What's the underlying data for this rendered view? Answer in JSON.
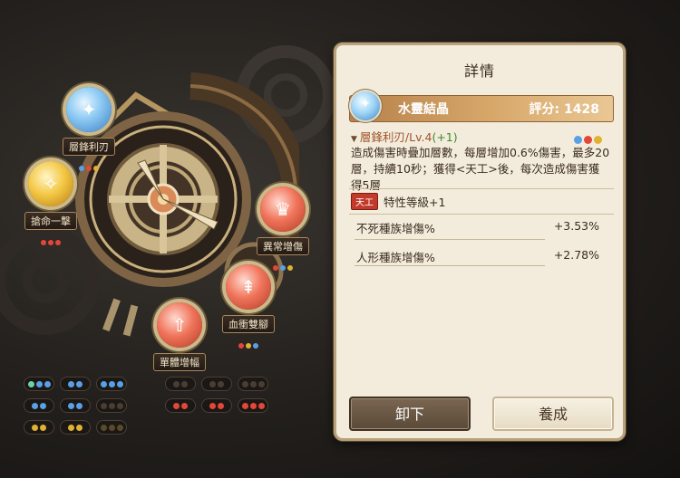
{
  "panel": {
    "title": "詳情",
    "item_name": "水靈結晶",
    "score_label": "評分:",
    "score_value": "1428",
    "skill_name": "層鋒利刃/Lv.4",
    "skill_bonus": "(+1)",
    "description": "造成傷害時疊加層數，每層增加0.6%傷害，最多20層，持續10秒；獲得<天工>後，每次造成傷害獲得5層",
    "trait_badge": "天工",
    "trait_text": "特性等級+1",
    "stats": [
      {
        "label": "不死種族增傷%",
        "value": "+3.53%"
      },
      {
        "label": "人形種族增傷%",
        "value": "+2.78%"
      }
    ],
    "buttons": {
      "unequip": "卸下",
      "develop": "養成"
    },
    "skill_dot_colors": [
      "#5aa0e6",
      "#e2473a",
      "#e0b232"
    ]
  },
  "nodes": [
    {
      "label": "層鋒利刃",
      "icon": "blade-icon",
      "orb": "blue",
      "dots": [
        "#5aa0e6",
        "#e2473a",
        "#e0b232"
      ]
    },
    {
      "label": "搶命一擊",
      "icon": "strike-icon",
      "orb": "gold",
      "dots": [
        "#e2473a",
        "#e2473a",
        "#e2473a"
      ]
    },
    {
      "label": "異常增傷",
      "icon": "crown-icon",
      "orb": "red",
      "dots": [
        "#e2473a",
        "#5aa0e6",
        "#e0b232"
      ]
    },
    {
      "label": "血衝雙腳",
      "icon": "double-strike-icon",
      "orb": "red",
      "dots": [
        "#e2473a",
        "#e0b232",
        "#5aa0e6"
      ]
    },
    {
      "label": "單體增幅",
      "icon": "single-boost-icon",
      "orb": "red",
      "dots": [
        "#e2473a",
        "#e2473a",
        "#e0b232"
      ]
    }
  ],
  "slot_rows": [
    [
      [
        "#6fd0a8",
        "#5aa0e6",
        "#5aa0e6"
      ],
      [
        "#5aa0e6",
        "#5aa0e6"
      ],
      [
        "#5aa0e6",
        "#5aa0e6",
        "#5aa0e6"
      ],
      [
        "#4a3d33",
        "#4a3d33"
      ],
      [
        "#4a3d33",
        "#4a3d33"
      ],
      [
        "#4a3d33",
        "#4a3d33",
        "#4a3d33"
      ]
    ],
    [
      [
        "#5aa0e6",
        "#5aa0e6"
      ],
      [
        "#5aa0e6",
        "#5aa0e6"
      ],
      [
        "#4a3d33",
        "#4a3d33",
        "#4a3d33"
      ],
      [
        "#e2473a",
        "#e2473a"
      ],
      [
        "#e2473a",
        "#e2473a"
      ],
      [
        "#e2473a",
        "#e2473a",
        "#e2473a"
      ]
    ],
    [
      [
        "#e0b232",
        "#e0b232"
      ],
      [
        "#e0b232",
        "#e0b232"
      ],
      [
        "#5b4a2a",
        "#5b4a2a",
        "#5b4a2a"
      ]
    ]
  ]
}
